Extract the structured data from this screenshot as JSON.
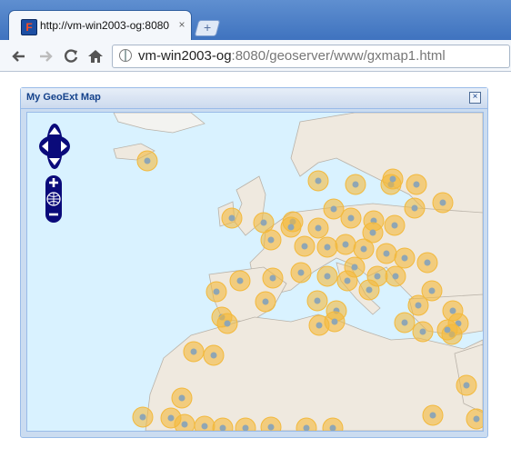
{
  "browser": {
    "tab_title": "http://vm-win2003-og:8080",
    "tab_close": "×",
    "new_tab": "+",
    "url_host": "vm-win2003-og",
    "url_rest": ":8080/geoserver/www/gxmap1.html",
    "favicon": "F",
    "icons": {
      "back": "back-arrow-icon",
      "forward": "forward-arrow-icon",
      "reload": "reload-icon",
      "home": "home-icon",
      "site": "globe-icon"
    }
  },
  "panel": {
    "title": "My GeoExt Map",
    "close": "×"
  },
  "map": {
    "zoom_in": "+",
    "zoom_out": "−",
    "colors": {
      "sea": "#d9f2ff",
      "land": "#efe9df",
      "marker_fill": "#f3b93c",
      "marker_center": "#8fa6b4",
      "control": "#0a0a7a"
    },
    "marker_count": 58
  }
}
